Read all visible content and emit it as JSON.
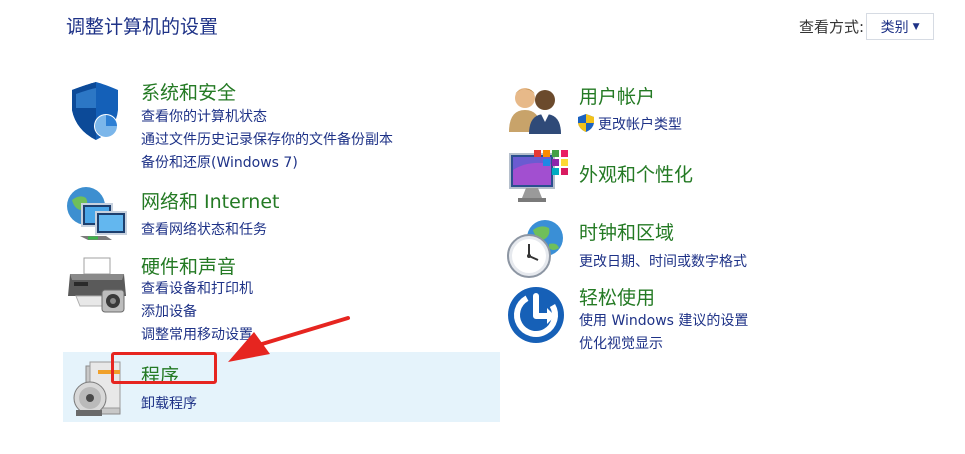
{
  "header": {
    "title": "调整计算机的设置",
    "view_by_label": "查看方式:",
    "view_by_value": "类别"
  },
  "categories_left": [
    {
      "id": "system-security",
      "title": "系统和安全",
      "icon": "shield-icon",
      "links": [
        "查看你的计算机状态",
        "通过文件历史记录保存你的文件备份副本",
        "备份和还原(Windows 7)"
      ]
    },
    {
      "id": "network",
      "title": "网络和 Internet",
      "icon": "network-globe-icon",
      "links": [
        "查看网络状态和任务"
      ]
    },
    {
      "id": "hardware",
      "title": "硬件和声音",
      "icon": "printer-icon",
      "links": [
        "查看设备和打印机",
        "添加设备",
        "调整常用移动设置"
      ]
    },
    {
      "id": "programs",
      "title": "程序",
      "icon": "programs-disc-icon",
      "links": [
        "卸载程序"
      ]
    }
  ],
  "categories_right": [
    {
      "id": "user-accounts",
      "title": "用户帐户",
      "icon": "users-icon",
      "links": [
        "更改帐户类型"
      ]
    },
    {
      "id": "appearance",
      "title": "外观和个性化",
      "icon": "monitor-tiles-icon",
      "links": []
    },
    {
      "id": "clock-region",
      "title": "时钟和区域",
      "icon": "clock-globe-icon",
      "links": [
        "更改日期、时间或数字格式"
      ]
    },
    {
      "id": "ease-of-access",
      "title": "轻松使用",
      "icon": "ease-of-access-icon",
      "links": [
        "使用 Windows 建议的设置",
        "优化视觉显示"
      ]
    }
  ],
  "colors": {
    "link": "#1e3287",
    "category_title": "#247a24",
    "hover_bg": "#e5f3fb",
    "annotation_red": "#e62520"
  }
}
